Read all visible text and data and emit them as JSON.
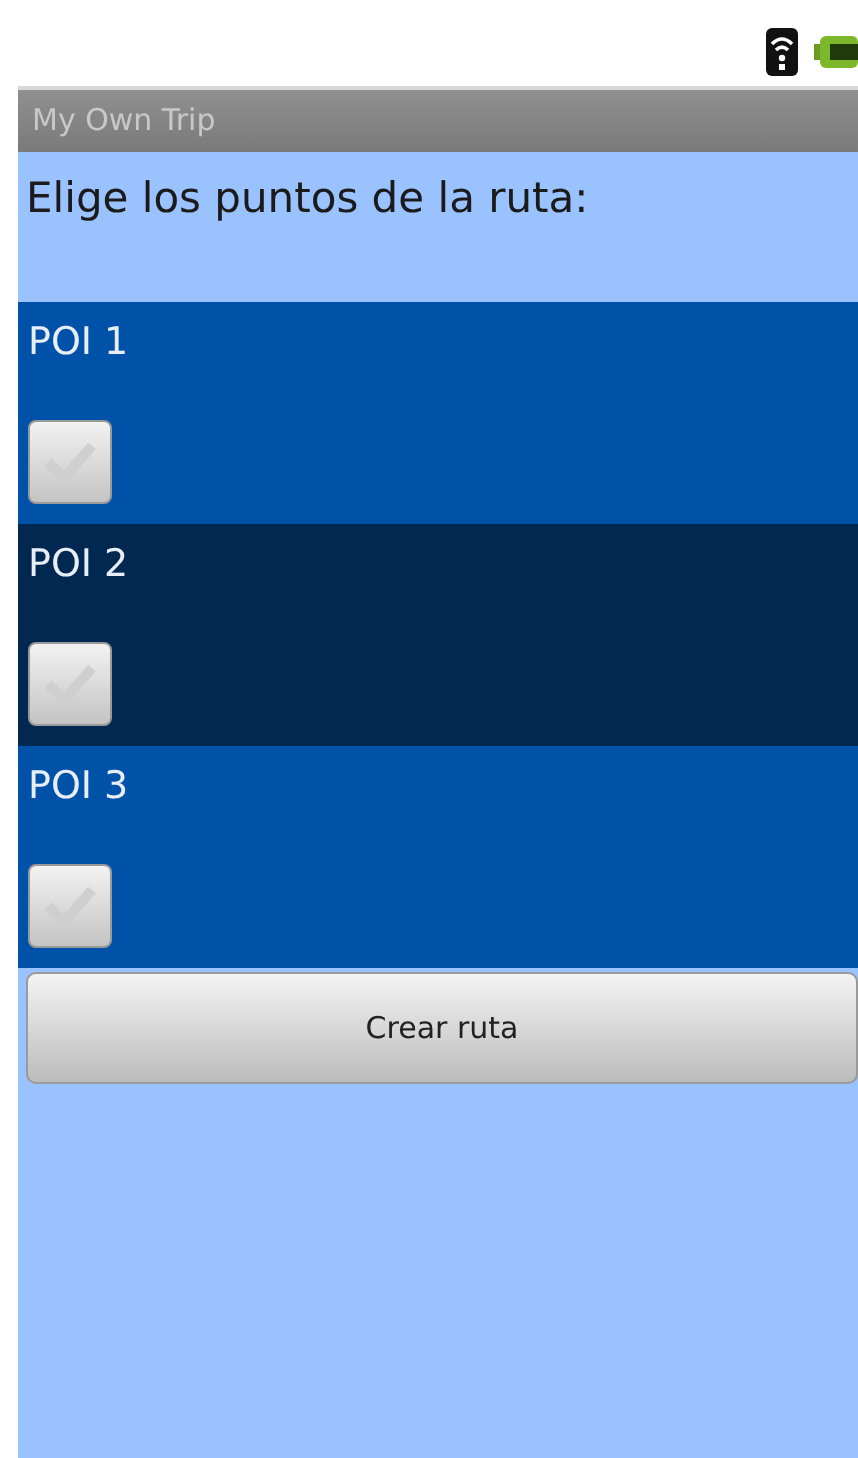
{
  "window": {
    "title": "My Own Trip"
  },
  "heading": "Elige los puntos de la ruta:",
  "pois": [
    {
      "label": "POI 1",
      "checked": false,
      "selected": false
    },
    {
      "label": "POI 2",
      "checked": false,
      "selected": true
    },
    {
      "label": "POI 3",
      "checked": false,
      "selected": false
    }
  ],
  "button": "Crear ruta"
}
